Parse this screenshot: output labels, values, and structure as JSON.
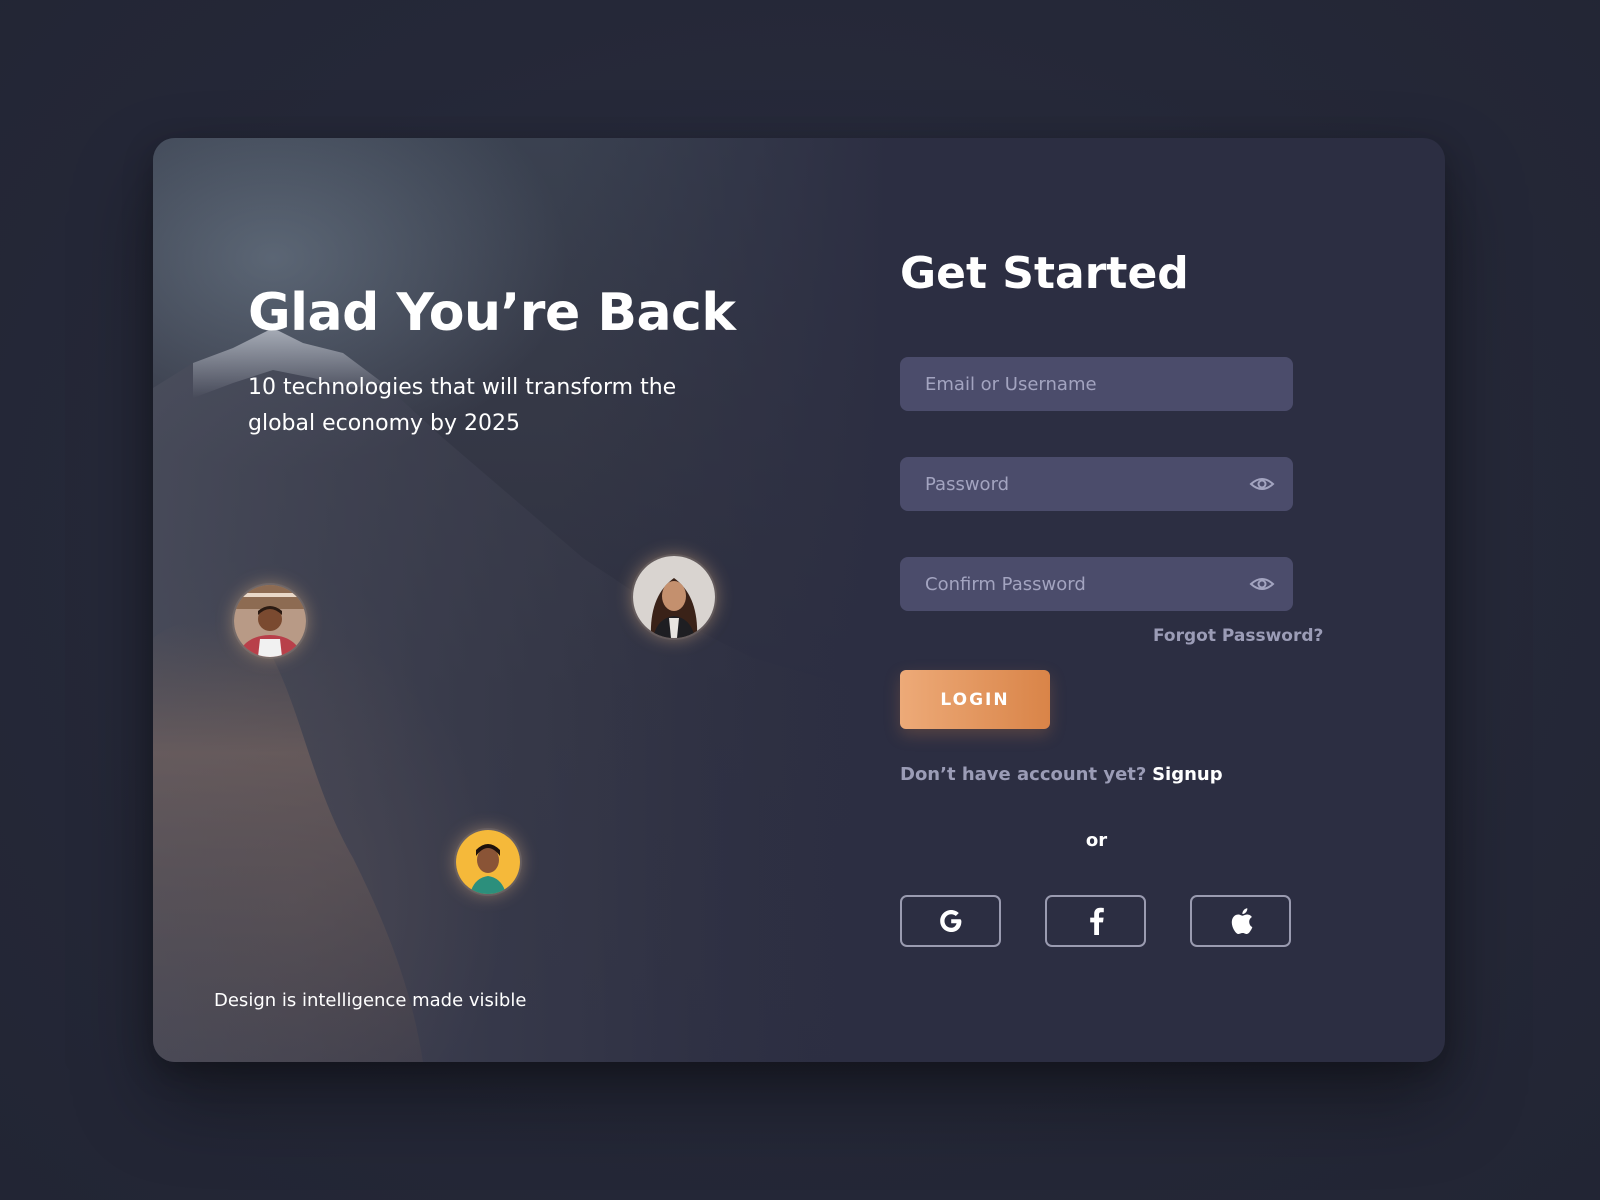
{
  "hero": {
    "title": "Glad You’re Back",
    "subtitle": "10 technologies that will transform the global economy by 2025",
    "tagline": "Design is intelligence made visible",
    "avatars": [
      "avatar-man-apron",
      "avatar-woman",
      "avatar-man-yellow"
    ]
  },
  "form": {
    "title": "Get Started",
    "email_placeholder": "Email or Username",
    "password_placeholder": "Password",
    "confirm_placeholder": "Confirm Password",
    "forgot_label": "Forgot Password?",
    "login_label": "LOGIN",
    "signup_prompt": "Don’t have account yet?",
    "signup_label": "Signup",
    "or_label": "or",
    "social": [
      {
        "name": "google",
        "icon": "google-icon"
      },
      {
        "name": "facebook",
        "icon": "facebook-icon"
      },
      {
        "name": "apple",
        "icon": "apple-icon"
      }
    ]
  },
  "colors": {
    "background": "#262939",
    "card": "#2c2e42",
    "field": "#4b4c6b",
    "accent_start": "#edaa78",
    "accent_end": "#d98448",
    "muted_text": "#9b9cb6"
  }
}
